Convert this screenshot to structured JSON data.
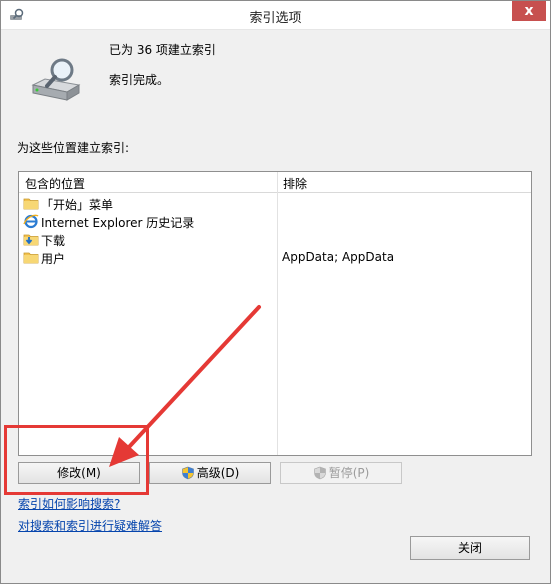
{
  "window": {
    "title": "索引选项",
    "close_label": "x"
  },
  "status": {
    "line1": "已为 36 项建立索引",
    "line2": "索引完成。"
  },
  "locations": {
    "caption": "为这些位置建立索引:",
    "col_included": "包含的位置",
    "col_excluded": "排除",
    "rows": [
      {
        "name": "「开始」菜单",
        "excluded": "",
        "icon": "folder-icon"
      },
      {
        "name": "Internet Explorer 历史记录",
        "excluded": "",
        "icon": "internet-explorer-icon"
      },
      {
        "name": "下载",
        "excluded": "",
        "icon": "download-folder-icon"
      },
      {
        "name": "用户",
        "excluded": "AppData; AppData",
        "icon": "folder-icon"
      }
    ]
  },
  "buttons": {
    "modify": "修改(M)",
    "advanced": "高级(D)",
    "pause": "暂停(P)",
    "close": "关闭"
  },
  "links": {
    "how_affects": "索引如何影响搜索?",
    "troubleshoot": "对搜索和索引进行疑难解答"
  },
  "colors": {
    "annotation": "#e53935",
    "close_button": "#c7504f",
    "link": "#0645ad"
  }
}
